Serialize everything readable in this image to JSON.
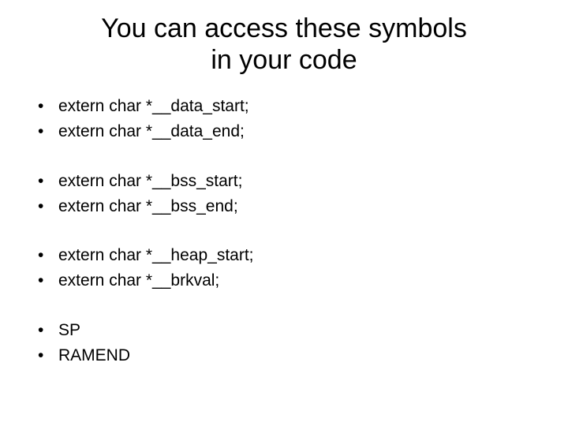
{
  "title_line1": "You can access these symbols",
  "title_line2": "in your code",
  "bullet_char": "•",
  "groups": [
    {
      "items": [
        "extern char *__data_start;",
        "extern char *__data_end;"
      ]
    },
    {
      "items": [
        "extern char *__bss_start;",
        "extern char *__bss_end;"
      ]
    },
    {
      "items": [
        "extern char *__heap_start;",
        "extern char *__brkval;"
      ]
    },
    {
      "items": [
        "SP",
        "RAMEND"
      ]
    }
  ]
}
